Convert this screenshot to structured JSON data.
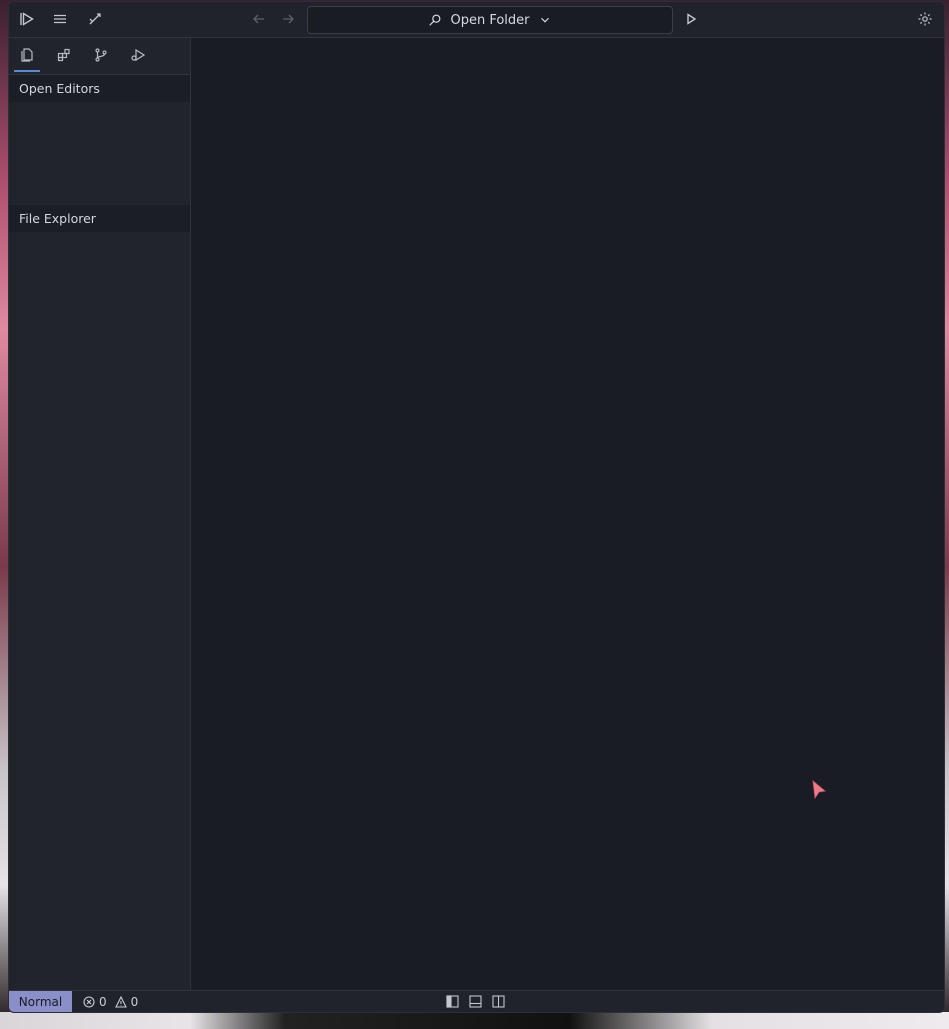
{
  "titlebar": {
    "search_label": "Open Folder",
    "icons": [
      "run-logo-icon",
      "menu-icon",
      "split-icon",
      "back-arrow-icon",
      "forward-arrow-icon",
      "search-icon",
      "chevron-down-icon",
      "play-icon",
      "settings-gear-icon"
    ]
  },
  "sidebar": {
    "tabs": [
      "files-icon",
      "extensions-icon",
      "source-control-icon",
      "debug-icon"
    ],
    "sections": {
      "open_editors": "Open Editors",
      "file_explorer": "File Explorer"
    }
  },
  "statusbar": {
    "mode": "Normal",
    "errors": "0",
    "warnings": "0",
    "layout_buttons": [
      "toggle-left-panel-icon",
      "toggle-bottom-panel-icon",
      "toggle-right-panel-icon"
    ]
  },
  "colors": {
    "accent": "#5b8bd6",
    "mode_badge": "#8b8fc9",
    "editor_bg": "#191c24",
    "sidebar_bg": "#21252b",
    "cursor": "#f07a8c"
  }
}
